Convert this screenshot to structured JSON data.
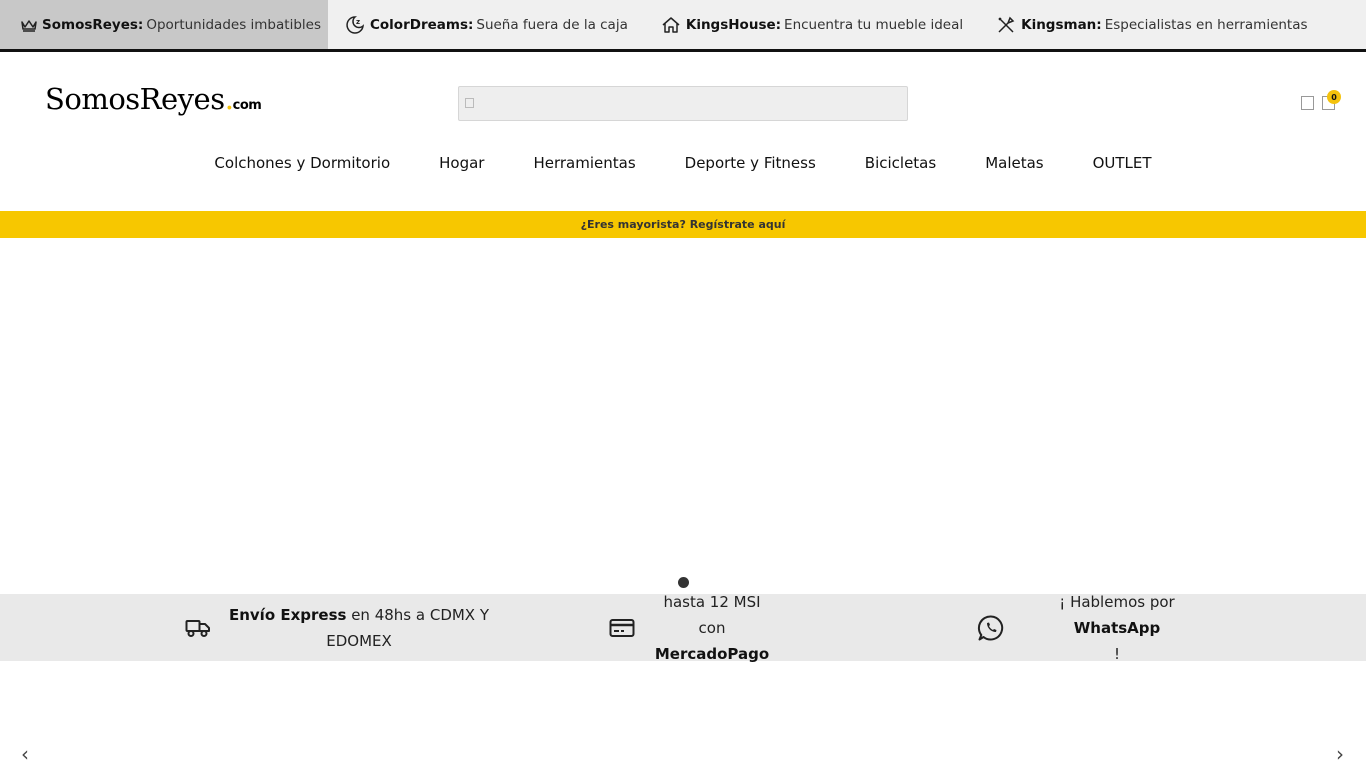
{
  "brand_bar": {
    "items": [
      {
        "icon": "crown-icon",
        "name": "SomosReyes:",
        "tagline": "Oportunidades imbatibles"
      },
      {
        "icon": "moon-sleep-icon",
        "name": "ColorDreams:",
        "tagline": "Sueña fuera de la caja"
      },
      {
        "icon": "house-icon",
        "name": "KingsHouse:",
        "tagline": "Encuentra tu mueble ideal"
      },
      {
        "icon": "tools-icon",
        "name": "Kingsman:",
        "tagline": "Especialistas en herramientas"
      }
    ]
  },
  "header": {
    "logo": {
      "name": "SomosReyes",
      "dot": ".",
      "suffix": "com"
    },
    "search": {
      "value": "",
      "placeholder": ""
    },
    "cart_count": "0"
  },
  "nav": {
    "items": [
      "Colchones y Dormitorio",
      "Hogar",
      "Herramientas",
      "Deporte y Fitness",
      "Bicicletas",
      "Maletas",
      "OUTLET"
    ]
  },
  "wholesale_banner": "¿Eres mayorista? Regístrate aquí",
  "benefits": {
    "express": {
      "bold": "Envío Express",
      "text": " en 48hs a CDMX Y EDOMEX"
    },
    "msi": {
      "text": "hasta 12 MSI con ",
      "bold": "MercadoPago"
    },
    "whatsapp": {
      "text": "¡ Hablemos por ",
      "bold": "WhatsApp",
      "end": "!"
    }
  },
  "carousel": {
    "prev": "‹",
    "next": "›"
  },
  "colors": {
    "accent": "#f7c700",
    "brandbar_bg": "#f0f0f0",
    "brandbar_active": "#c8c8c8",
    "benefits_bg": "#e9e9e9"
  }
}
